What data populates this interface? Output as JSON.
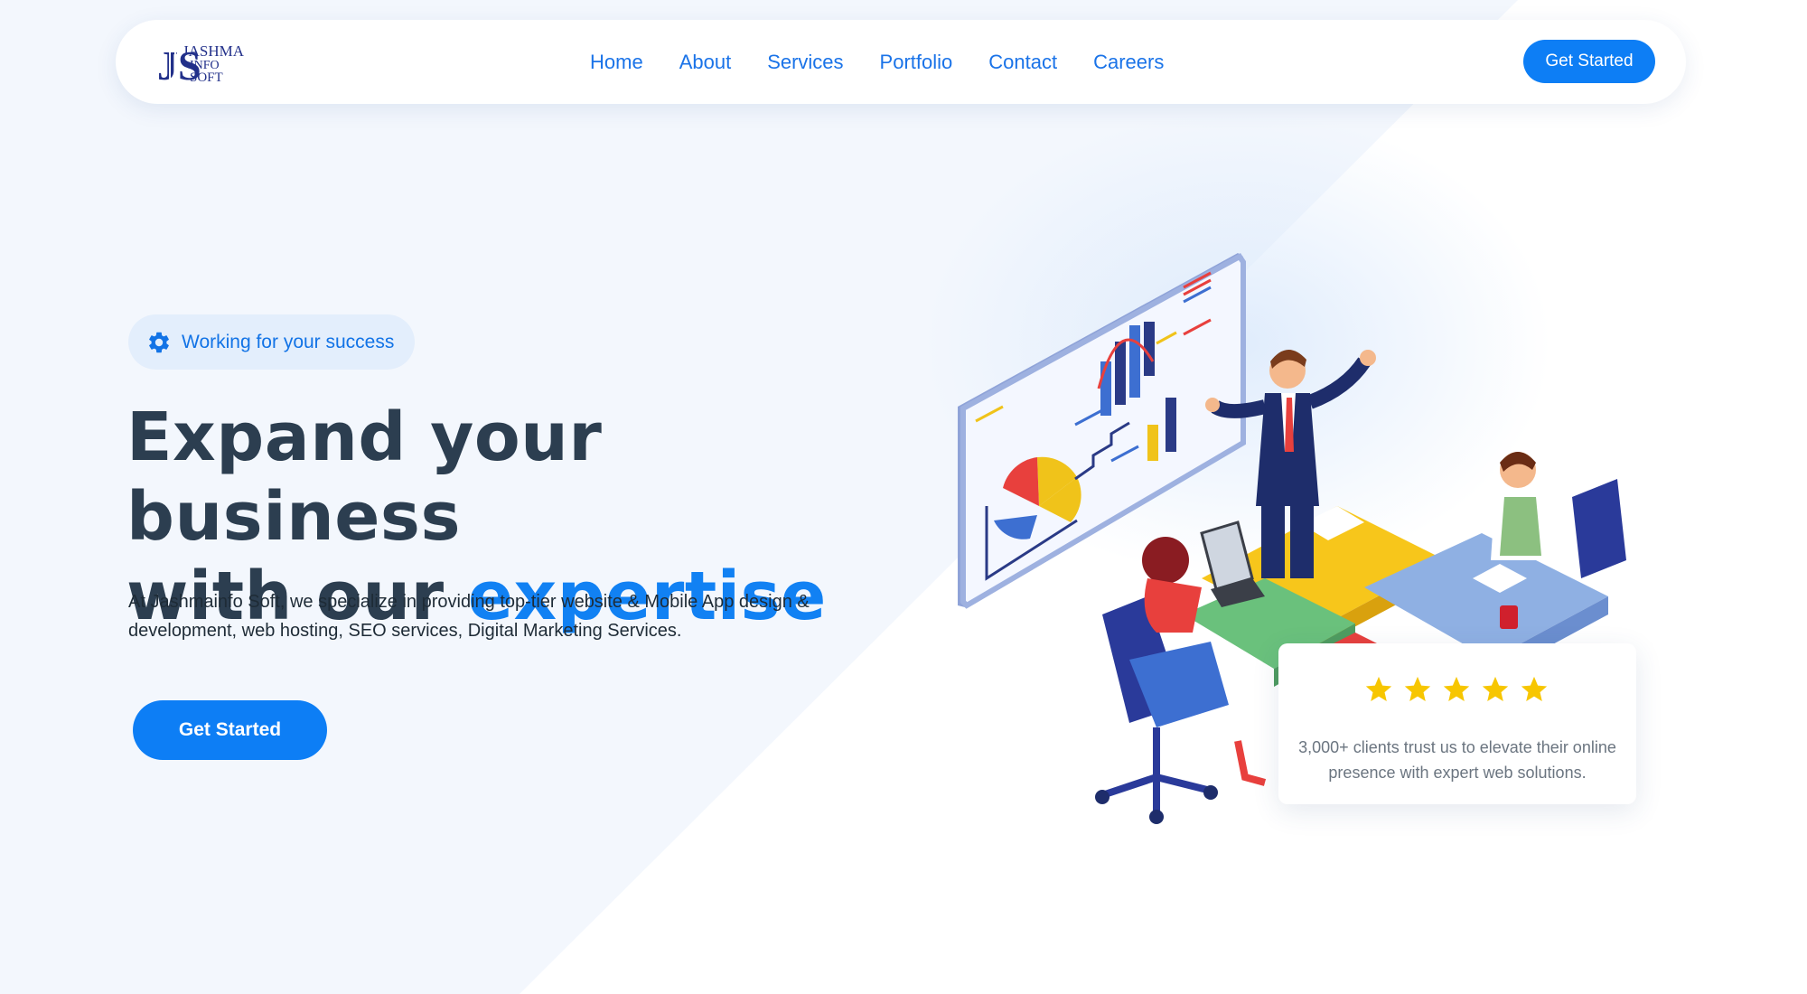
{
  "brand": {
    "logo_text_line1": "JASHMA",
    "logo_text_line2": "INFO",
    "logo_text_line3": "SOFT",
    "logo_monogram": "JS"
  },
  "nav": {
    "links": [
      {
        "label": "Home"
      },
      {
        "label": "About"
      },
      {
        "label": "Services"
      },
      {
        "label": "Portfolio"
      },
      {
        "label": "Contact"
      },
      {
        "label": "Careers"
      }
    ],
    "cta_label": "Get Started"
  },
  "hero": {
    "badge_icon": "gear-icon",
    "badge_text": "Working for your success",
    "headline_line1": "Expand your business",
    "headline_line2_prefix": "with our ",
    "headline_line2_accent": "expertise",
    "intro": "At Jashmainfo Soft, we specialize in providing top-tier website & Mobile App design & development, web hosting, SEO services, Digital Marketing Services.",
    "cta_label": "Get Started"
  },
  "review": {
    "stars": 5,
    "text": "3,000+ clients trust us to elevate their online presence with expert web solutions."
  },
  "colors": {
    "accent": "#0d7ef5",
    "nav_link": "#1a73e8",
    "headline": "#2c3e50",
    "star": "#f7c600",
    "background": "#f3f7fd"
  }
}
